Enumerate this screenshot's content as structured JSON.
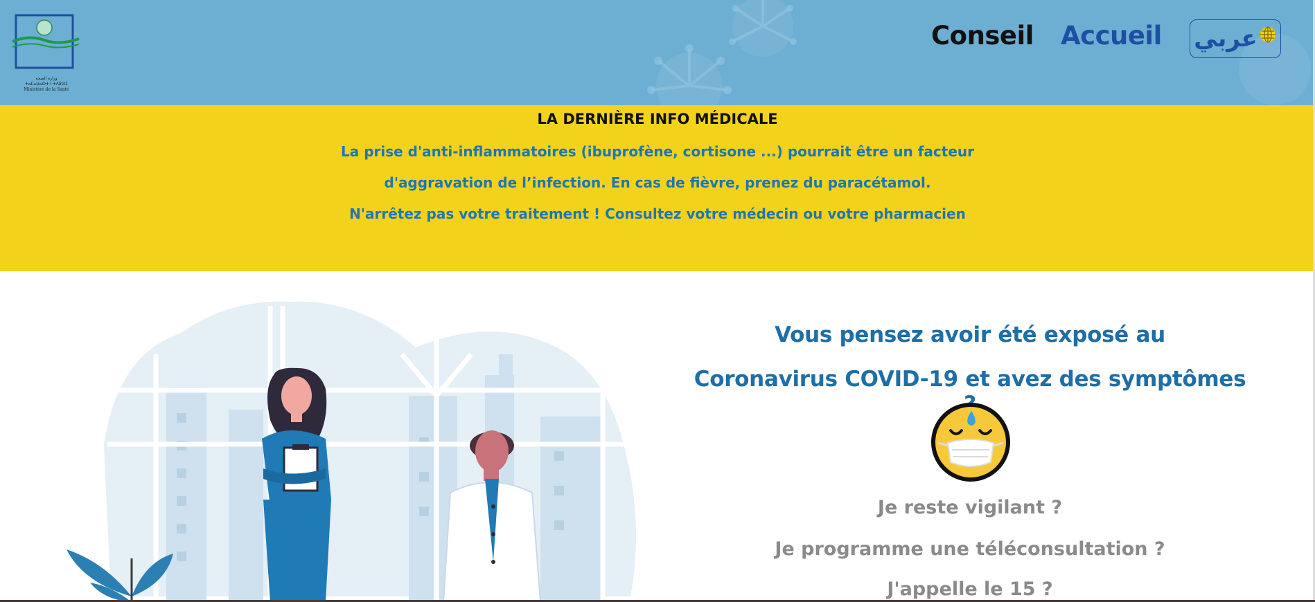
{
  "header": {
    "logo_caption_line1": "وزارة الصحة",
    "logo_caption_line2": "ⵜⴰⵎⴰⵡⴰⵙⵜ ⵏ ⵜⴷⵓⵙⵉ",
    "logo_caption_line3": "Ministère de la Santé",
    "nav": {
      "conseil": "Conseil",
      "accueil": "Accueil"
    },
    "language_button": "عربي",
    "language_icon": "globe-icon"
  },
  "banner": {
    "title": "LA DERNIÈRE INFO MÉDICALE",
    "lines": [
      "La prise d'anti-inflammatoires (ibuprofène, cortisone ...) pourrait être un facteur",
      "d'aggravation de l’infection. En cas de fièvre, prenez du paracétamol.",
      "N'arrêtez pas votre traitement ! Consultez votre médecin ou votre pharmacien"
    ]
  },
  "main": {
    "question": [
      "Vous pensez avoir été exposé au",
      "Coronavirus COVID-19 et avez des symptômes ?"
    ],
    "emoji_icon": "masked-face-emoji-icon",
    "options": [
      "Je reste vigilant ?",
      "Je programme une téléconsultation ?",
      "J'appelle le 15 ?"
    ]
  },
  "colors": {
    "header_bg": "#6dafd2",
    "banner_bg": "#f3d21c",
    "accent_blue": "#1e6ea7",
    "nav_blue": "#1e4fa3",
    "option_gray": "#8a8a8a"
  }
}
